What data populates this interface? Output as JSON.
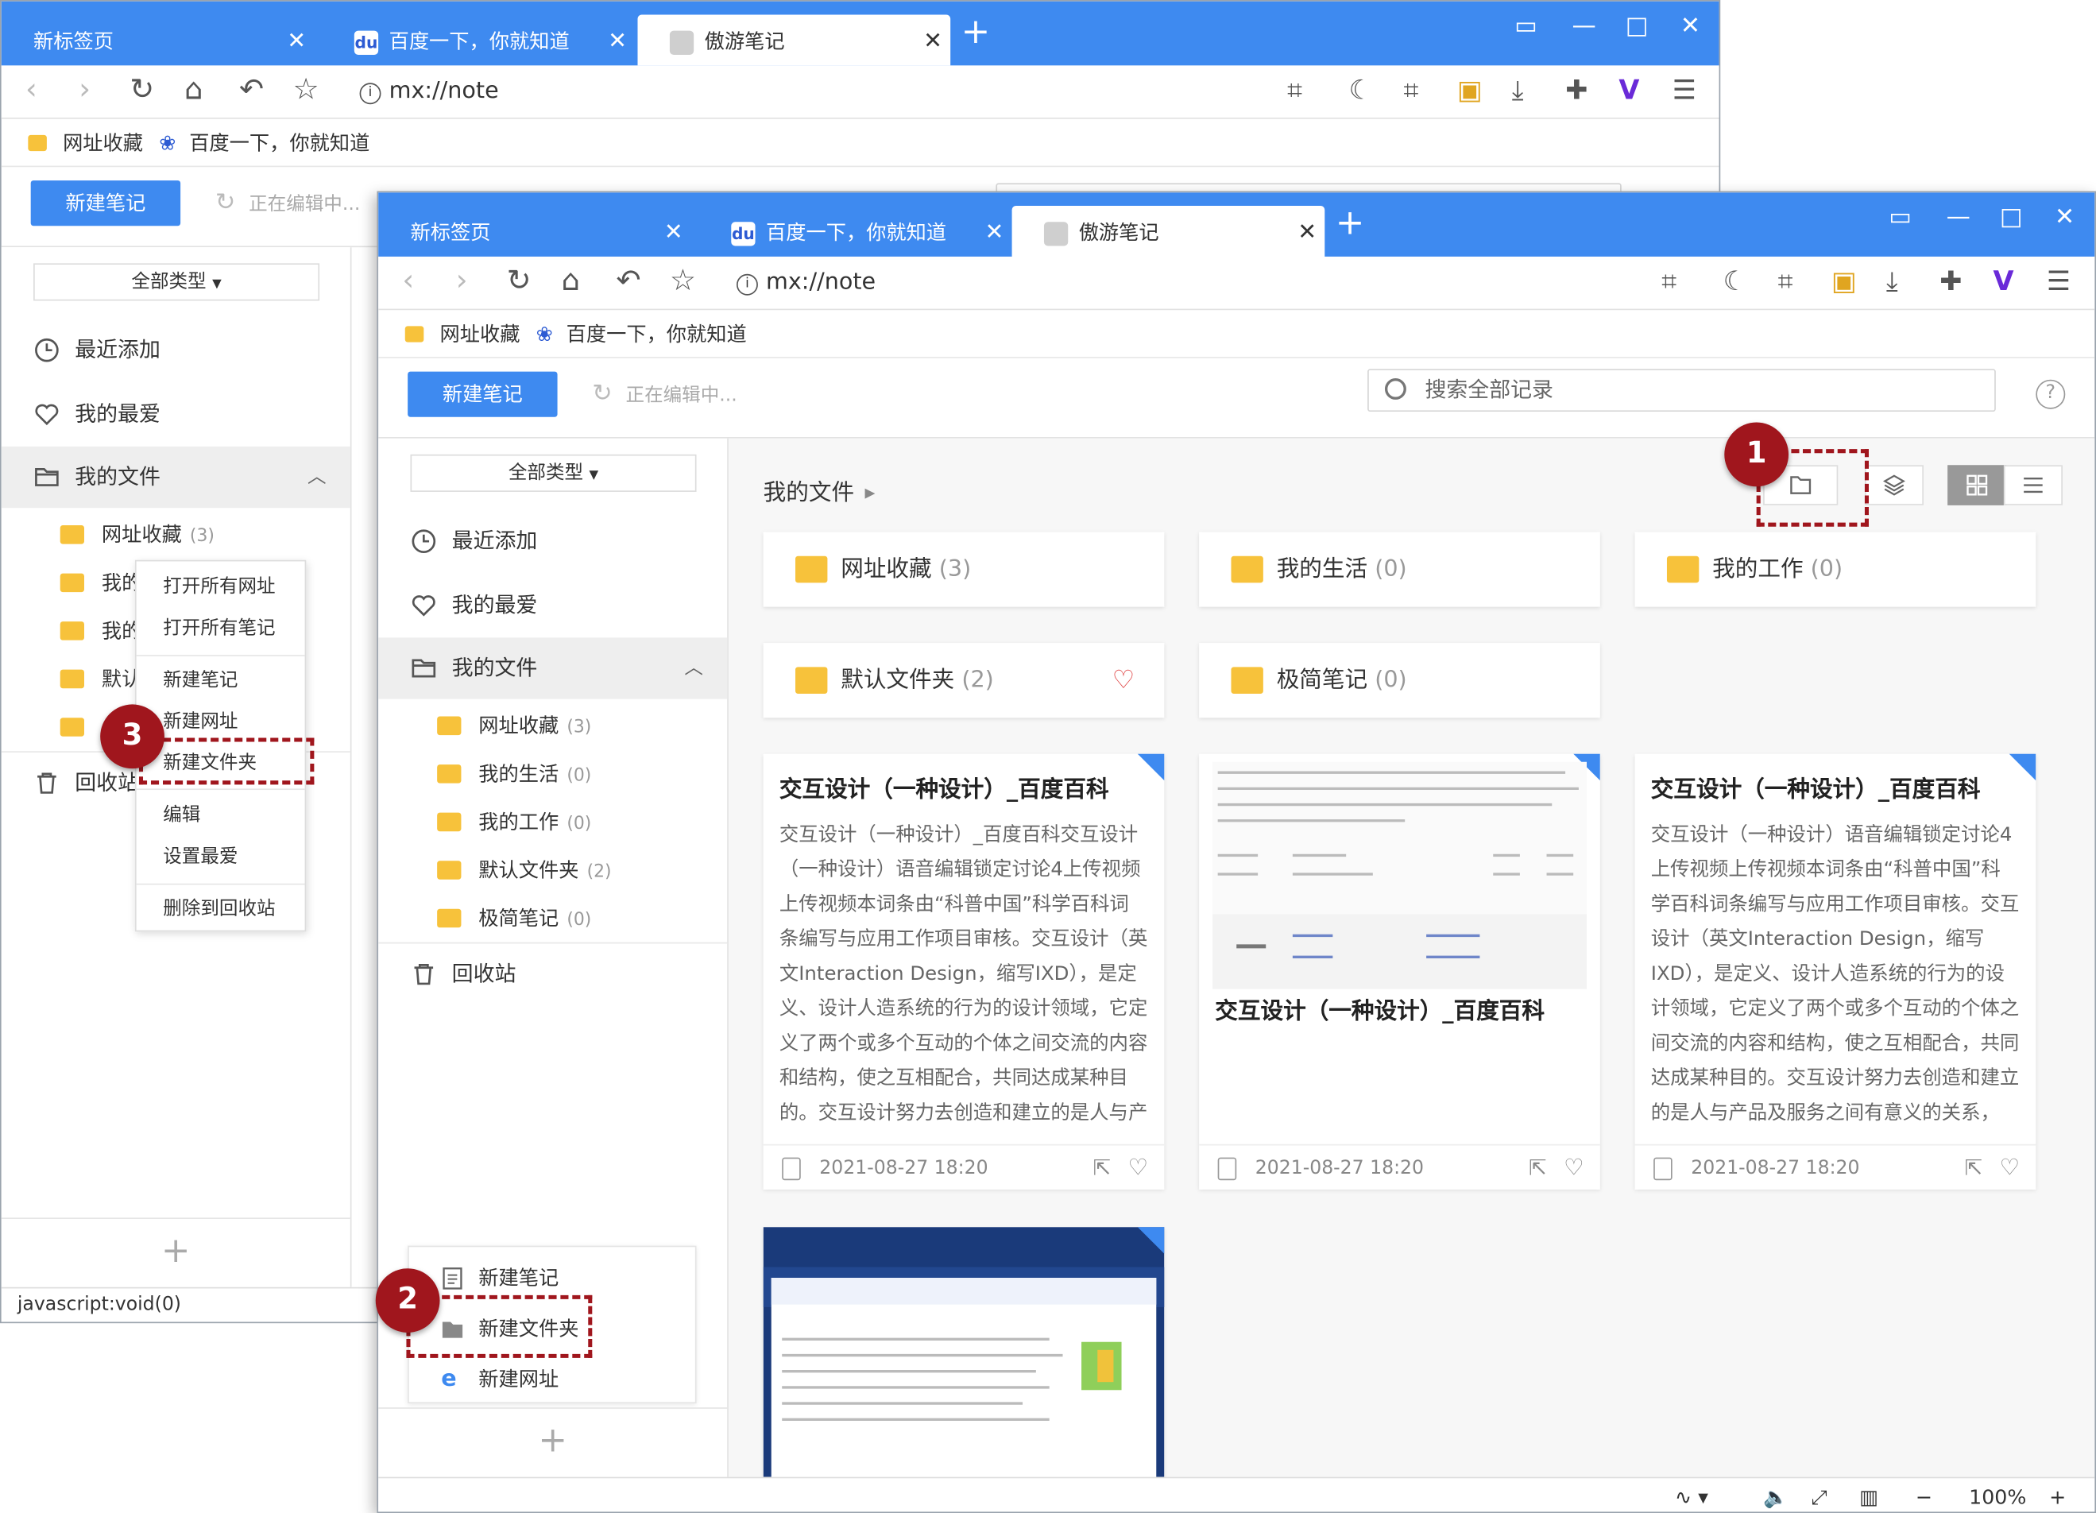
{
  "tabs": [
    {
      "label": "新标签页"
    },
    {
      "label": "百度一下，你就知道"
    },
    {
      "label": "傲游笔记"
    }
  ],
  "address": {
    "url": "mx://note"
  },
  "bookmarks": [
    {
      "label": "网址收藏"
    },
    {
      "label": "百度一下，你就知道"
    }
  ],
  "toolbar": {
    "new_note": "新建笔记",
    "editing": "正在编辑中...",
    "search_placeholder": "搜索全部记录",
    "help": "?"
  },
  "sidebar": {
    "type_filter": "全部类型",
    "recent": "最近添加",
    "favorites": "我的最爱",
    "my_files": "我的文件",
    "folders": [
      {
        "name": "网址收藏",
        "count": "(3)"
      },
      {
        "name": "我的生活",
        "count": "(0)"
      },
      {
        "name": "我的工作",
        "count": "(0)"
      },
      {
        "name": "默认文件夹",
        "count": "(2)"
      },
      {
        "name": "极简笔记",
        "count": "(0)"
      }
    ],
    "trash": "回收站",
    "add": "+"
  },
  "back_window": {
    "editing": "正在编辑中...",
    "folder_fragments": [
      "我的",
      "我的",
      "默认"
    ],
    "trash_fragment": "回收站",
    "status": "javascript:void(0)"
  },
  "context_menu": {
    "items": [
      "打开所有网址",
      "打开所有笔记",
      "新建笔记",
      "新建网址",
      "新建文件夹",
      "编辑",
      "设置最爱",
      "删除到回收站"
    ]
  },
  "main": {
    "breadcrumb": "我的文件",
    "folder_cards": [
      {
        "name": "网址收藏",
        "count": "(3)"
      },
      {
        "name": "我的生活",
        "count": "(0)"
      },
      {
        "name": "我的工作",
        "count": "(0)"
      },
      {
        "name": "默认文件夹",
        "count": "(2)"
      },
      {
        "name": "极简笔记",
        "count": "(0)"
      }
    ],
    "notes": [
      {
        "title": "交互设计（一种设计）_百度百科",
        "body": "交互设计（一种设计）_百度百科交互设计（一种设计）语音编辑锁定讨论4上传视频上传视频本词条由“科普中国”科学百科词条编写与应用工作项目审核。交互设计（英文Interaction Design，缩写IXD），是定义、设计人造系统的行为的设计领域，它定义了两个或多个互动的个体之间交流的内容和结构，使之互相配合，共同达成某种目的。交互设计努力去创造和建立的是人与产品及...",
        "date": "2021-08-27  18:20"
      },
      {
        "title": "交互设计（一种设计）_百度百科",
        "date": "2021-08-27  18:20"
      },
      {
        "title": "交互设计（一种设计）_百度百科",
        "body": "交互设计（一种设计）语音编辑锁定讨论4上传视频上传视频本词条由“科普中国”科学百科词条编写与应用工作项目审核。交互设计（英文Interaction Design，缩写IXD），是定义、设计人造系统的行为的设计领域，它定义了两个或多个互动的个体之间交流的内容和结构，使之互相配合，共同达成某种目的。交互设计努力去创造和建立的是人与产品及服务之间有意义的关系，以“在充满社...",
        "date": "2021-08-27  18:20"
      }
    ]
  },
  "add_menu": {
    "items": [
      "新建笔记",
      "新建文件夹",
      "新建网址"
    ]
  },
  "statusbar": {
    "zoom": "100%"
  },
  "badges": [
    "1",
    "2",
    "3"
  ],
  "colors": {
    "accent": "#3e8af0",
    "annotation": "#a0161d",
    "folder": "#f7c23b",
    "heart": "#e04848"
  }
}
